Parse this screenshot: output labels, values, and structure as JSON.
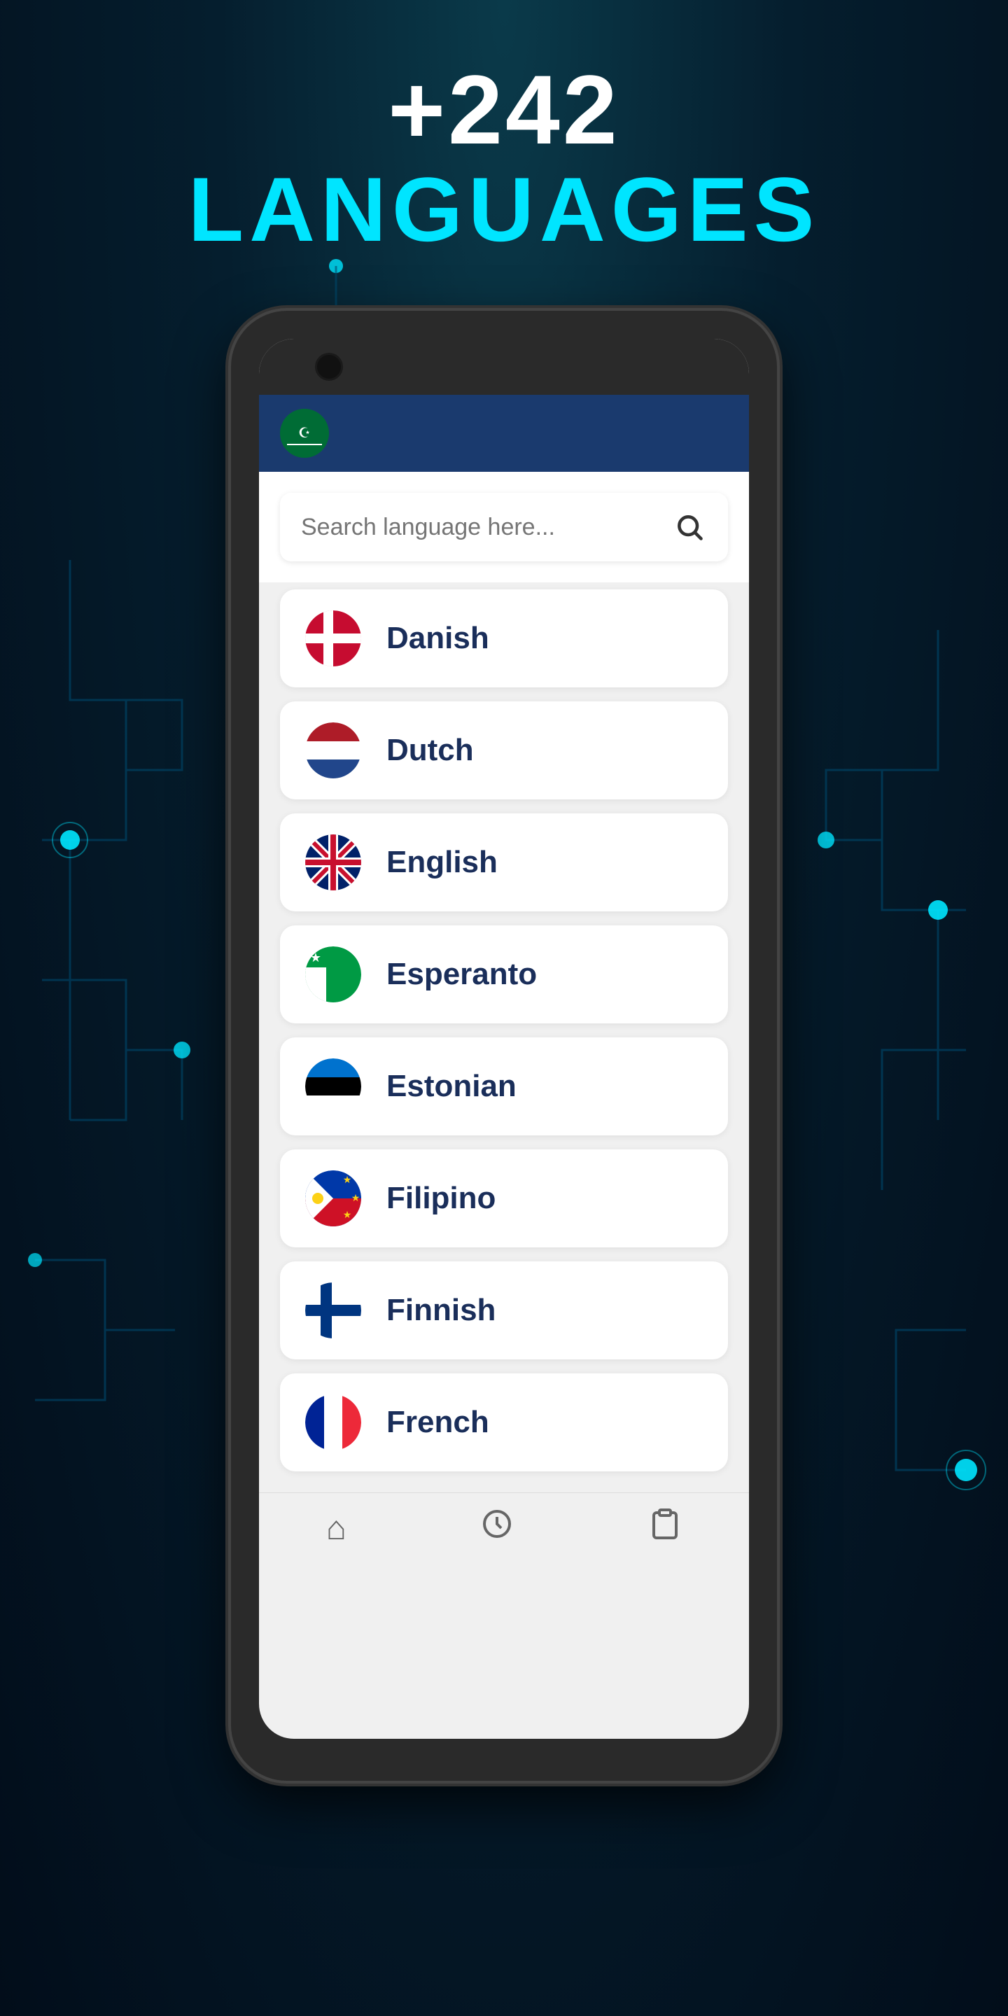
{
  "header": {
    "count": "+242",
    "subtitle": "LANGUAGES"
  },
  "search": {
    "placeholder": "Search language here..."
  },
  "languages": [
    {
      "id": "danish",
      "name": "Danish",
      "flag_type": "danish"
    },
    {
      "id": "dutch",
      "name": "Dutch",
      "flag_type": "dutch"
    },
    {
      "id": "english",
      "name": "English",
      "flag_type": "english"
    },
    {
      "id": "esperanto",
      "name": "Esperanto",
      "flag_type": "esperanto"
    },
    {
      "id": "estonian",
      "name": "Estonian",
      "flag_type": "estonian"
    },
    {
      "id": "filipino",
      "name": "Filipino",
      "flag_type": "filipino"
    },
    {
      "id": "finnish",
      "name": "Finnish",
      "flag_type": "finnish"
    },
    {
      "id": "french",
      "name": "French",
      "flag_type": "french"
    }
  ],
  "colors": {
    "accent": "#00e5ff",
    "dark_blue": "#1a3a6e",
    "background_start": "#0a3a4a",
    "background_end": "#020d1a"
  }
}
